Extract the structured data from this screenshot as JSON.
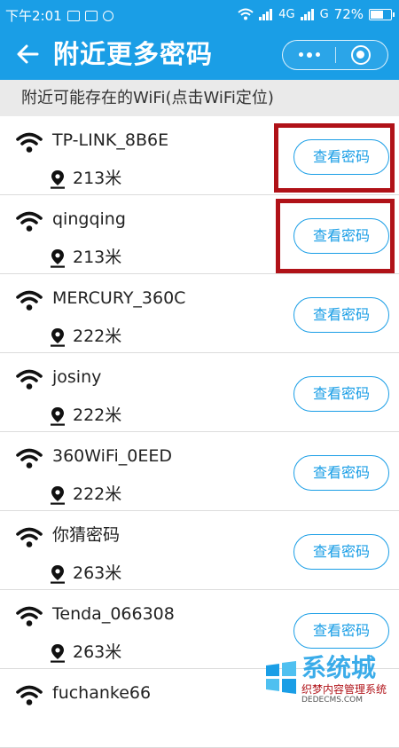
{
  "status_bar": {
    "time": "下午2:01",
    "network_4g": "4G",
    "network_g": "G",
    "battery_percent": "72%",
    "battery_level": 0.72
  },
  "nav": {
    "title": "附近更多密码"
  },
  "section_header": "附近可能存在的WiFi(点击WiFi定位)",
  "wifi_list": [
    {
      "ssid": "TP-LINK_8B6E",
      "distance": "213米",
      "button_label": "查看密码"
    },
    {
      "ssid": "qingqing",
      "distance": "213米",
      "button_label": "查看密码"
    },
    {
      "ssid": "MERCURY_360C",
      "distance": "222米",
      "button_label": "查看密码"
    },
    {
      "ssid": "josiny",
      "distance": "222米",
      "button_label": "查看密码"
    },
    {
      "ssid": "360WiFi_0EED",
      "distance": "222米",
      "button_label": "查看密码"
    },
    {
      "ssid": "你猜密码",
      "distance": "263米",
      "button_label": "查看密码"
    },
    {
      "ssid": "Tenda_066308",
      "distance": "263米",
      "button_label": "查看密码"
    },
    {
      "ssid": "fuchanke66",
      "distance": "",
      "button_label": ""
    }
  ],
  "watermark": {
    "brand": "系统城",
    "subtitle": "织梦内容管理系统",
    "url": "DEDECMS.COM"
  },
  "colors": {
    "accent": "#1a9ee6",
    "highlight": "#b01218",
    "header_bg": "#eaeaea"
  }
}
